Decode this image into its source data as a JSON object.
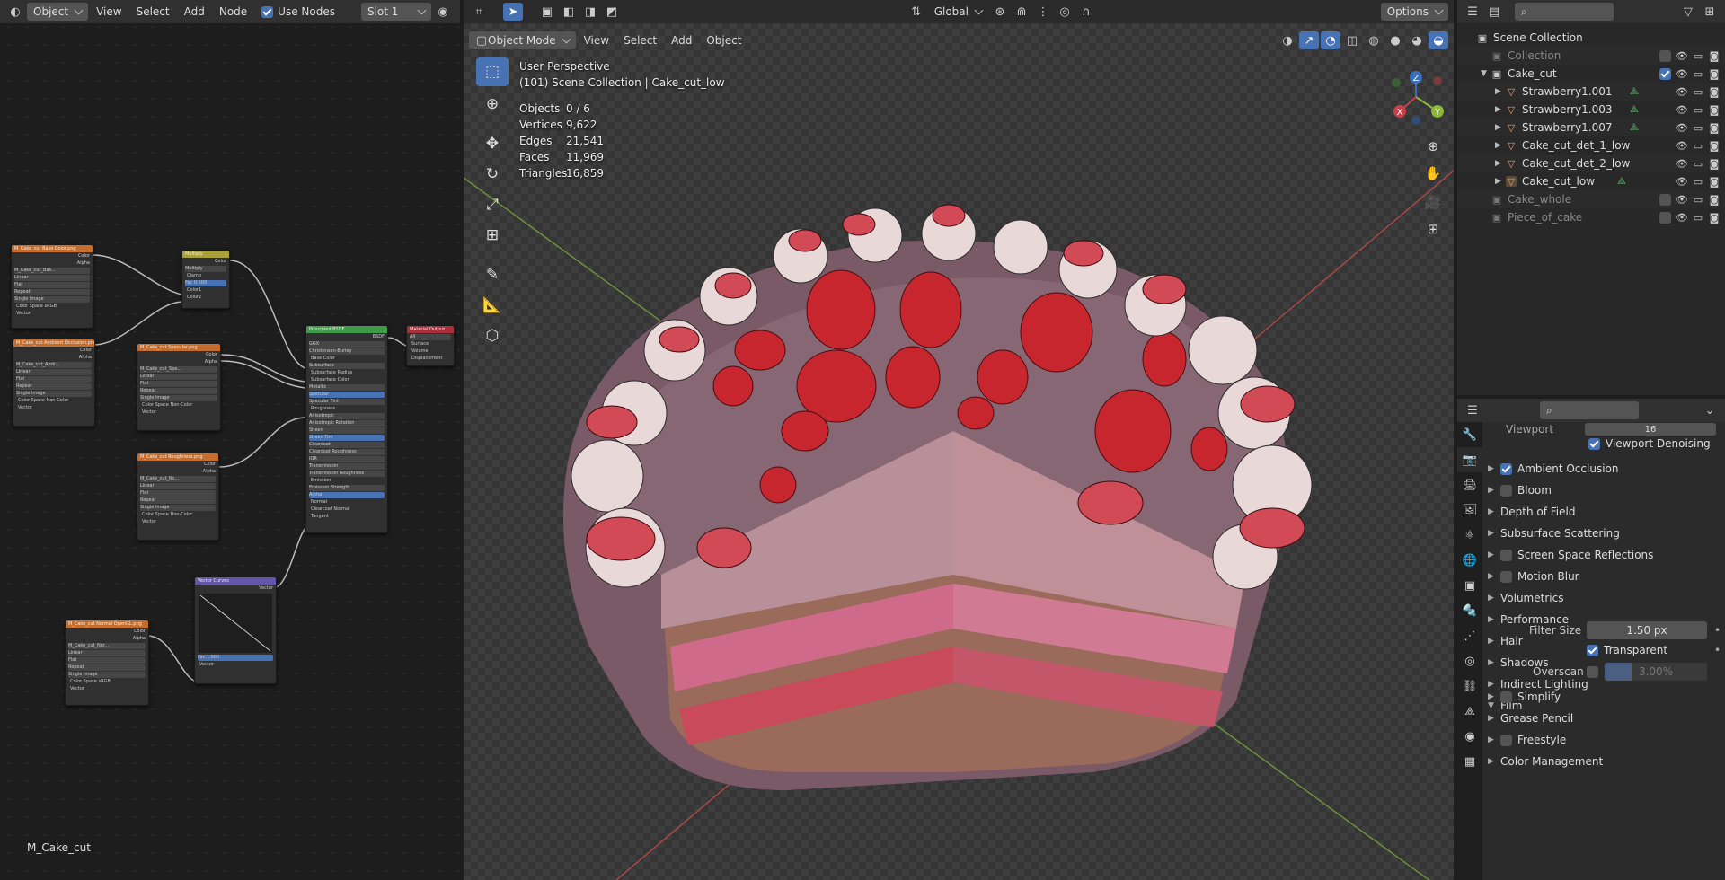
{
  "node_editor": {
    "header": {
      "mode": "Object",
      "menu": [
        "View",
        "Select",
        "Add",
        "Node"
      ],
      "use_nodes_label": "Use Nodes",
      "slot": "Slot 1"
    },
    "material_name": "M_Cake_cut",
    "nodes": {
      "base_color": {
        "title": "M_Cake_cut Base Color.png",
        "outputs": [
          "Color",
          "Alpha"
        ],
        "rows": [
          "M_Cake_cut_Bas...",
          "Linear",
          "Flat",
          "Repeat",
          "Single Image",
          "Color Space",
          "sRGB",
          "Vector"
        ]
      },
      "ambient_occlusion": {
        "title": "M_Cake_cut Ambient Occlusion.png",
        "outputs": [
          "Color",
          "Alpha"
        ],
        "rows": [
          "M_Cake_cut_Amb...",
          "Linear",
          "Flat",
          "Repeat",
          "Single Image",
          "Color Space",
          "Non-Color",
          "Vector"
        ]
      },
      "multiply": {
        "title": "Multiply",
        "outputs": [
          "Color"
        ],
        "rows": [
          "Multiply",
          "Clamp",
          "Fac",
          "0.500",
          "Color1",
          "Color2"
        ]
      },
      "specular": {
        "title": "M_Cake_cut Specular.png",
        "outputs": [
          "Color",
          "Alpha"
        ],
        "rows": [
          "M_Cake_cut_Spe...",
          "Linear",
          "Flat",
          "Repeat",
          "Single Image",
          "Color Space",
          "Non-Color",
          "Vector"
        ]
      },
      "roughness": {
        "title": "M_Cake_cut Roughness.png",
        "outputs": [
          "Color",
          "Alpha"
        ],
        "rows": [
          "M_Cake_cut_Ro...",
          "Linear",
          "Flat",
          "Repeat",
          "Single Image",
          "Color Space",
          "Non-Color",
          "Vector"
        ]
      },
      "principled": {
        "title": "Principled BSDF",
        "outputs": [
          "BSDF"
        ],
        "rows": [
          "GGX",
          "Christensen-Burley",
          "Base Color",
          "Subsurface",
          "Subsurface Radius",
          "Subsurface Color",
          "Metallic",
          "Specular",
          "Specular Tint",
          "Roughness",
          "Anisotropic",
          "Anisotropic Rotation",
          "Sheen",
          "Sheen Tint",
          "Clearcoat",
          "Clearcoat Roughness",
          "IOR",
          "Transmission",
          "Transmission Roughness",
          "Emission",
          "Emission Strength",
          "Alpha",
          "Normal",
          "Clearcoat Normal",
          "Tangent"
        ]
      },
      "output": {
        "title": "Material Output",
        "rows": [
          "All",
          "Surface",
          "Volume",
          "Displacement"
        ]
      },
      "vector_curves": {
        "title": "Vector Curves",
        "outputs": [
          "Vector"
        ],
        "rows": [
          "Fac",
          "1.000",
          "Vector"
        ]
      },
      "normal": {
        "title": "M_Cake_cut Normal OpenGL.png",
        "outputs": [
          "Color",
          "Alpha"
        ],
        "rows": [
          "M_Cake_cut_Nor...",
          "Linear",
          "Flat",
          "Repeat",
          "Single Image",
          "Color Space",
          "sRGB",
          "Vector"
        ]
      }
    }
  },
  "viewport": {
    "header": {
      "orientation": "Global",
      "options_label": "Options",
      "mode": "Object Mode",
      "menu": [
        "View",
        "Select",
        "Add",
        "Object"
      ]
    },
    "overlay_title": "User Perspective",
    "overlay_subtitle": "(101) Scene Collection | Cake_cut_low",
    "stats": [
      {
        "label": "Objects",
        "value": "0 / 6"
      },
      {
        "label": "Vertices",
        "value": "9,622"
      },
      {
        "label": "Edges",
        "value": "21,541"
      },
      {
        "label": "Faces",
        "value": "11,969"
      },
      {
        "label": "Triangles",
        "value": "16,859"
      }
    ],
    "gizmo": {
      "x": "X",
      "y": "Y",
      "z": "Z"
    }
  },
  "outliner": {
    "root": "Scene Collection",
    "items": [
      {
        "name": "Collection",
        "dim": true
      },
      {
        "name": "Cake_cut",
        "dim": false
      },
      {
        "name": "Strawberry1.001",
        "dim": false
      },
      {
        "name": "Strawberry1.003",
        "dim": false
      },
      {
        "name": "Strawberry1.007",
        "dim": false
      },
      {
        "name": "Cake_cut_det_1_low",
        "dim": false
      },
      {
        "name": "Cake_cut_det_2_low",
        "dim": false
      },
      {
        "name": "Cake_cut_low",
        "dim": false
      },
      {
        "name": "Cake_whole",
        "dim": true
      },
      {
        "name": "Piece_of_cake",
        "dim": true
      }
    ]
  },
  "properties": {
    "viewport_label": "Viewport",
    "viewport_value": "16",
    "viewport_denoising": "Viewport Denoising",
    "panels": [
      {
        "label": "Ambient Occlusion",
        "checkbox": true,
        "checked": true
      },
      {
        "label": "Bloom",
        "checkbox": true,
        "checked": false
      },
      {
        "label": "Depth of Field",
        "checkbox": false
      },
      {
        "label": "Subsurface Scattering",
        "checkbox": false
      },
      {
        "label": "Screen Space Reflections",
        "checkbox": true,
        "checked": false
      },
      {
        "label": "Motion Blur",
        "checkbox": true,
        "checked": false
      },
      {
        "label": "Volumetrics",
        "checkbox": false
      },
      {
        "label": "Performance",
        "checkbox": false
      },
      {
        "label": "Hair",
        "checkbox": false
      },
      {
        "label": "Shadows",
        "checkbox": false
      },
      {
        "label": "Indirect Lighting",
        "checkbox": false
      },
      {
        "label": "Film",
        "checkbox": false,
        "open": true
      }
    ],
    "film": {
      "filter_size_label": "Filter Size",
      "filter_size_value": "1.50 px",
      "transparent_label": "Transparent",
      "overscan_label": "Overscan",
      "overscan_value": "3.00%"
    },
    "panels_after": [
      {
        "label": "Simplify",
        "checkbox": true,
        "checked": false
      },
      {
        "label": "Grease Pencil",
        "checkbox": false
      },
      {
        "label": "Freestyle",
        "checkbox": true,
        "checked": false
      },
      {
        "label": "Color Management",
        "checkbox": false
      }
    ]
  }
}
